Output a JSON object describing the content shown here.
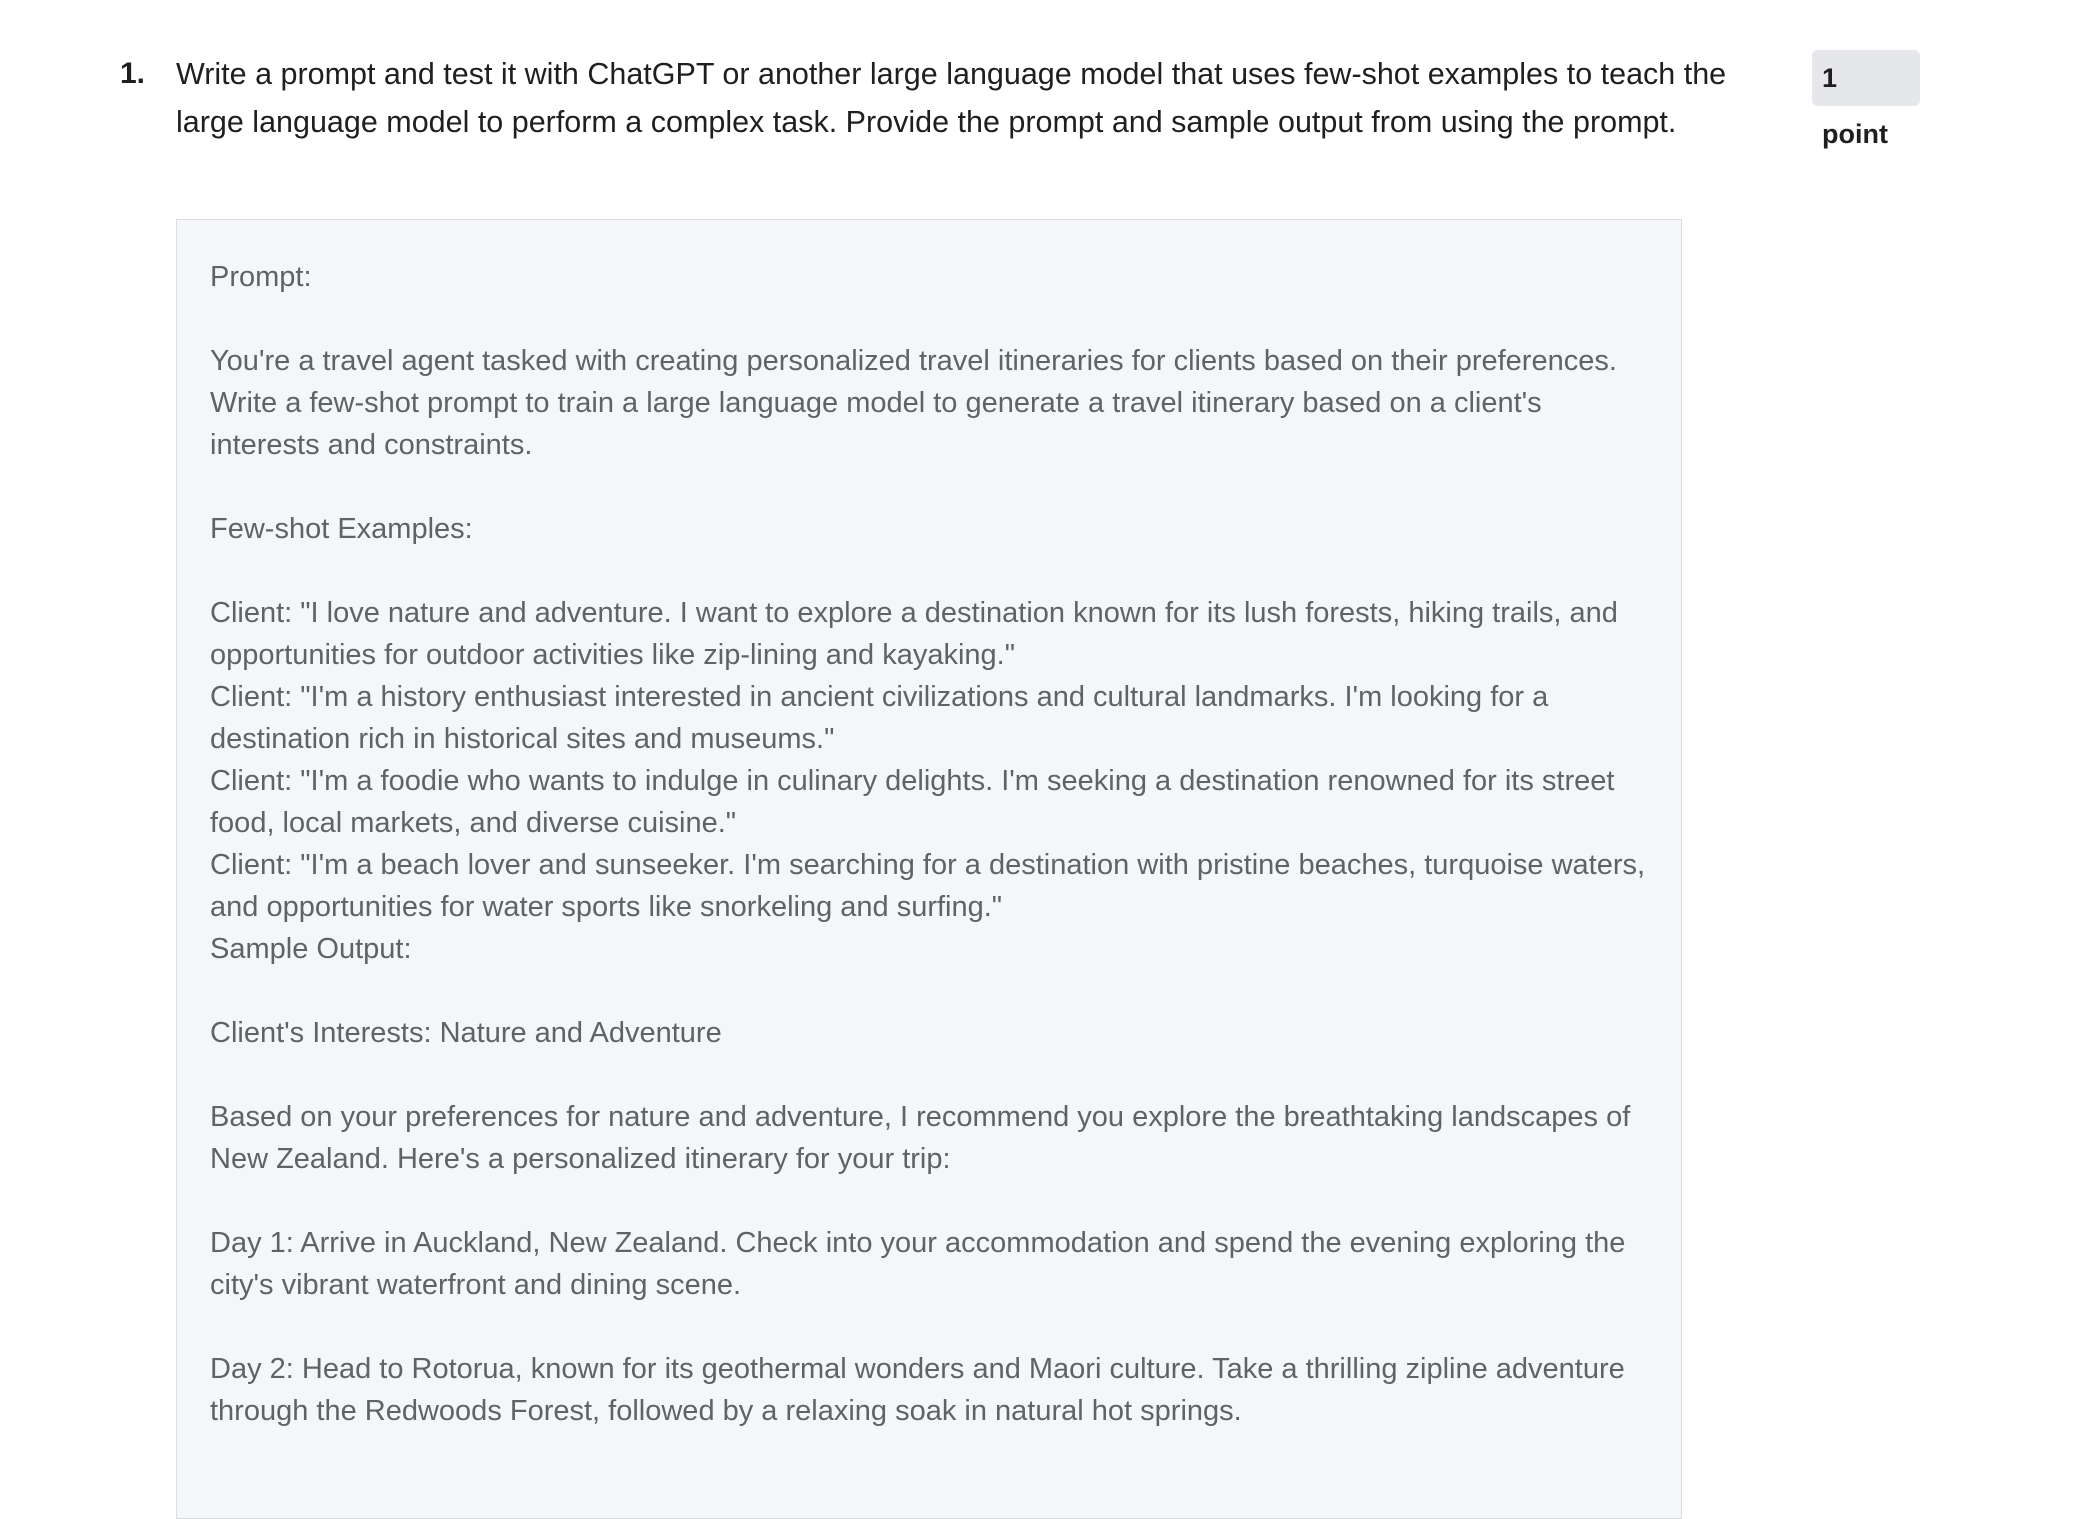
{
  "question": {
    "number": "1.",
    "text": "Write a prompt and test it with ChatGPT or another large language model that uses few-shot examples to teach the large language model to perform a complex task. Provide the prompt and sample output from using the prompt.",
    "points": "1 point"
  },
  "answer": {
    "prompt_label": "Prompt:",
    "prompt_body": "You're a travel agent tasked with creating personalized travel itineraries for clients based on their preferences. Write a few-shot prompt to train a large language model to generate a travel itinerary based on a client's interests and constraints.",
    "examples_label": "Few-shot Examples:",
    "example_1": "Client: \"I love nature and adventure. I want to explore a destination known for its lush forests, hiking trails, and opportunities for outdoor activities like zip-lining and kayaking.\"",
    "example_2": "Client: \"I'm a history enthusiast interested in ancient civilizations and cultural landmarks. I'm looking for a destination rich in historical sites and museums.\"",
    "example_3": "Client: \"I'm a foodie who wants to indulge in culinary delights. I'm seeking a destination renowned for its street food, local markets, and diverse cuisine.\"",
    "example_4": "Client: \"I'm a beach lover and sunseeker. I'm searching for a destination with pristine beaches, turquoise waters, and opportunities for water sports like snorkeling and surfing.\"",
    "sample_output_label": "Sample Output:",
    "interests": "Client's Interests: Nature and Adventure",
    "recommendation": "Based on your preferences for nature and adventure, I recommend you explore the breathtaking landscapes of New Zealand. Here's a personalized itinerary for your trip:",
    "day_1": "Day 1: Arrive in Auckland, New Zealand. Check into your accommodation and spend the evening exploring the city's vibrant waterfront and dining scene.",
    "day_2": "Day 2: Head to Rotorua, known for its geothermal wonders and Maori culture. Take a thrilling zipline adventure through the Redwoods Forest, followed by a relaxing soak in natural hot springs."
  }
}
